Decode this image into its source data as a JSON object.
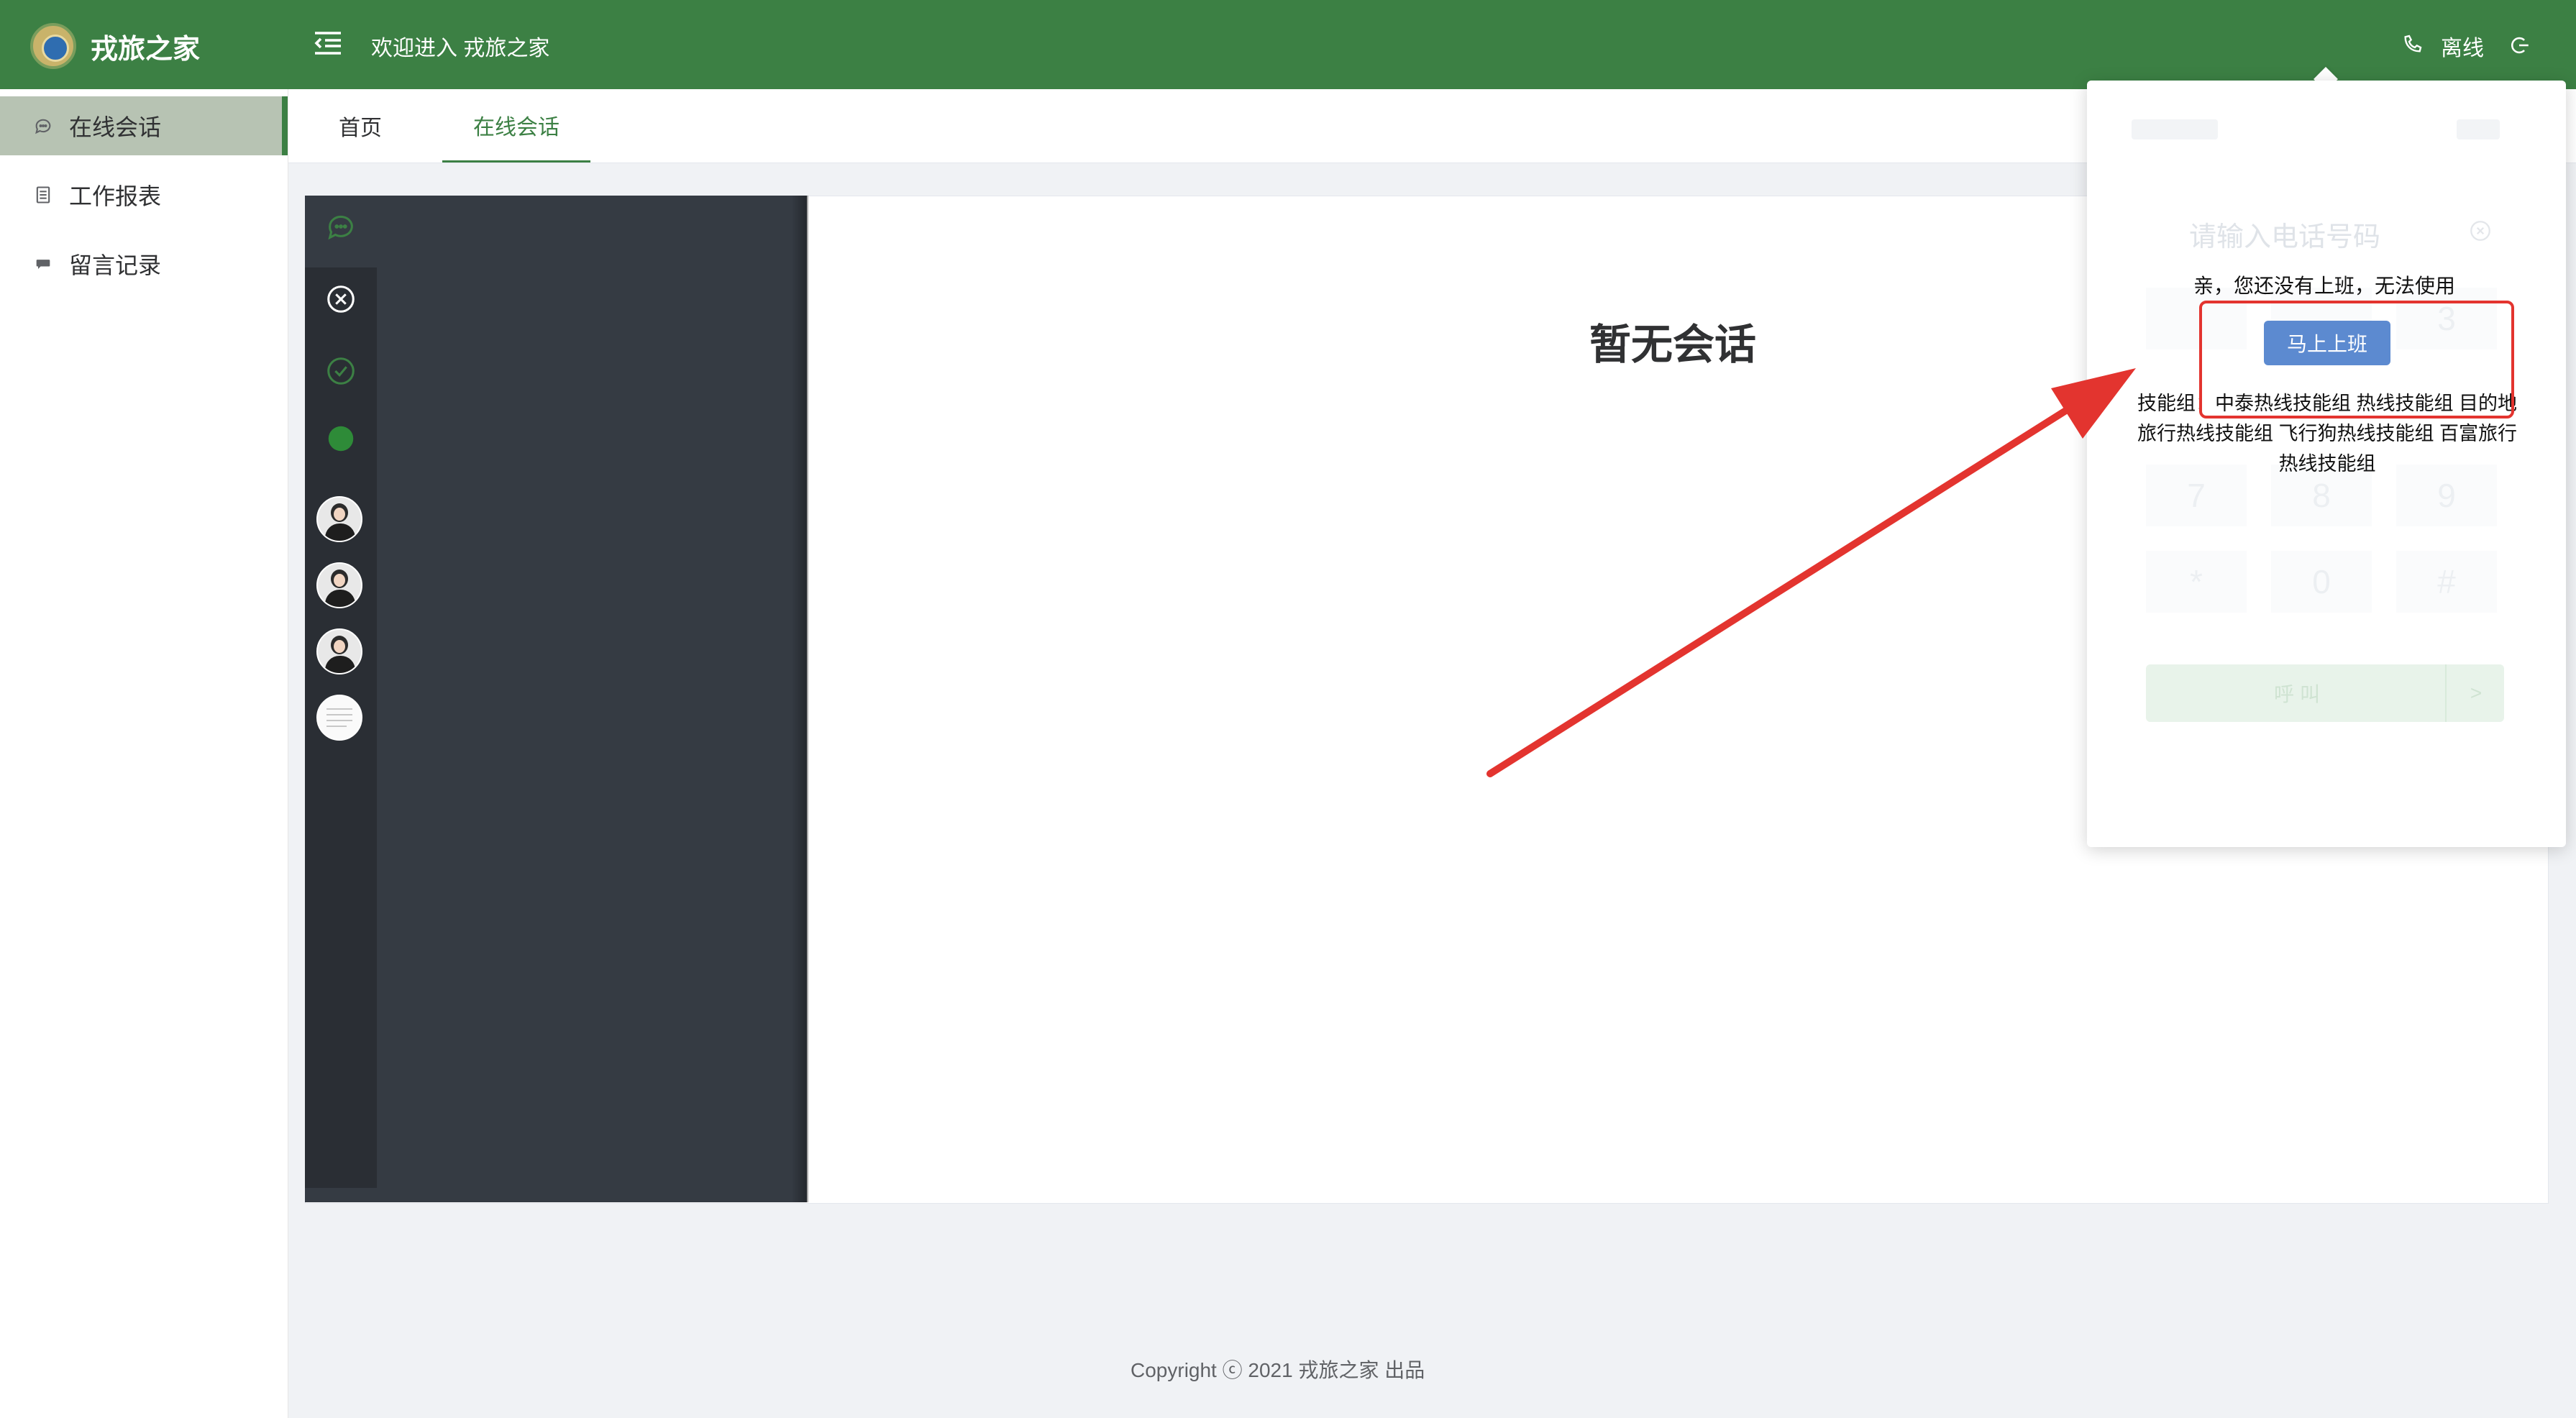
{
  "app": {
    "title": "戎旅之家",
    "logo_icon": "emblem-logo"
  },
  "header": {
    "welcome": "欢迎进入 戎旅之家",
    "status": "离线",
    "color": "#3c8044"
  },
  "sidebar": {
    "items": [
      {
        "label": "在线会话",
        "icon": "chat-bubble-icon",
        "active": true
      },
      {
        "label": "工作报表",
        "icon": "document-icon",
        "active": false
      },
      {
        "label": "留言记录",
        "icon": "message-icon",
        "active": false
      }
    ]
  },
  "tabs": [
    {
      "label": "首页",
      "active": false
    },
    {
      "label": "在线会话",
      "active": true
    }
  ],
  "main": {
    "empty_text": "暂无会话"
  },
  "phone_panel": {
    "input_placeholder": "请输入电话号码",
    "keys": [
      "3",
      "7",
      "8",
      "9",
      "*",
      "0",
      "#"
    ],
    "call_label": "呼叫",
    "call_arrow": ">",
    "notice": "亲，您还没有上班，无法使用",
    "onduty_button": "马上上班",
    "skills": "技能组：中泰热线技能组 热线技能组 目的地旅行热线技能组 飞行狗热线技能组 百富旅行热线技能组"
  },
  "footer": {
    "text": "Copyright ⓒ 2021 戎旅之家 出品"
  },
  "annotation": {
    "color": "#e3342f"
  }
}
